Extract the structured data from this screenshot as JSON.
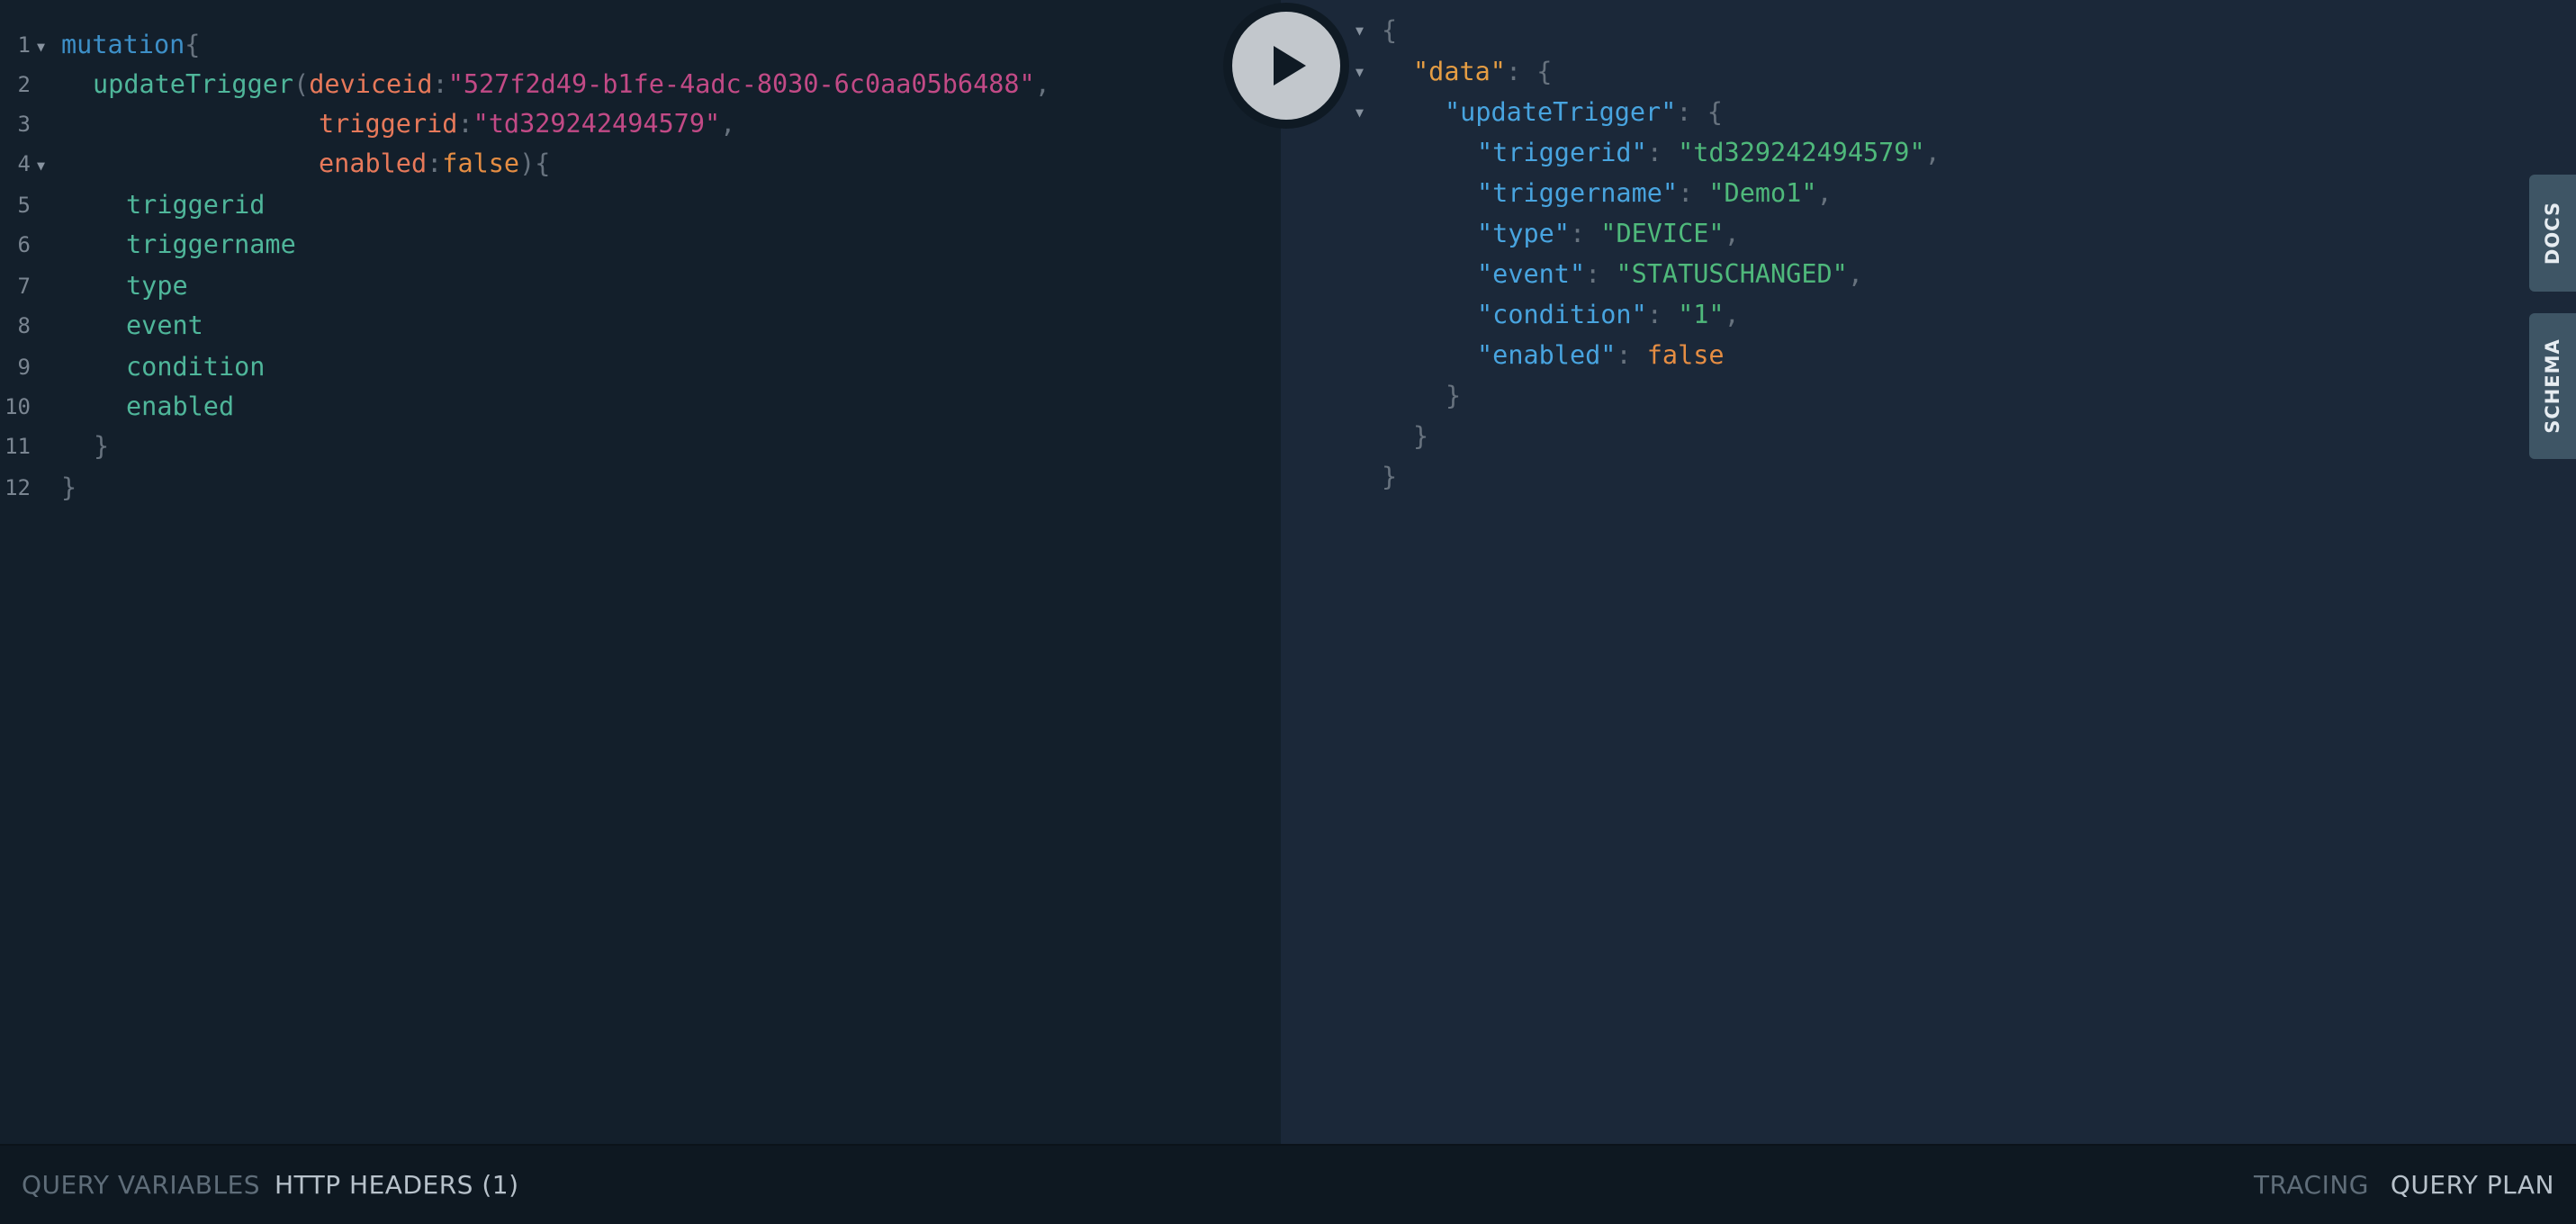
{
  "query_editor": {
    "line_numbers": [
      "1",
      "2",
      "3",
      "4",
      "5",
      "6",
      "7",
      "8",
      "9",
      "10",
      "11",
      "12"
    ],
    "keyword": "mutation",
    "operation": "updateTrigger",
    "arg_deviceid_name": "deviceid",
    "arg_deviceid_value": "\"527f2d49-b1fe-4adc-8030-6c0aa05b6488\"",
    "arg_triggerid_name": "triggerid",
    "arg_triggerid_value": "\"td329242494579\"",
    "arg_enabled_name": "enabled",
    "arg_enabled_value": "false",
    "fields": [
      "triggerid",
      "triggername",
      "type",
      "event",
      "condition",
      "enabled"
    ]
  },
  "result": {
    "data_key": "\"data\"",
    "update_key": "\"updateTrigger\"",
    "entries": [
      {
        "key": "\"triggerid\"",
        "value": "\"td329242494579\""
      },
      {
        "key": "\"triggername\"",
        "value": "\"Demo1\""
      },
      {
        "key": "\"type\"",
        "value": "\"DEVICE\""
      },
      {
        "key": "\"event\"",
        "value": "\"STATUSCHANGED\""
      },
      {
        "key": "\"condition\"",
        "value": "\"1\""
      },
      {
        "key": "\"enabled\"",
        "value": "false"
      }
    ]
  },
  "side_tabs": {
    "docs": "DOCS",
    "schema": "SCHEMA"
  },
  "bottom_bar": {
    "query_variables": "QUERY VARIABLES",
    "http_headers": "HTTP HEADERS (1)",
    "tracing": "TRACING",
    "query_plan": "QUERY PLAN"
  },
  "colors": {
    "editor_bg": "#131f2b",
    "result_bg": "#1b2839",
    "keyword": "#3d8fc7",
    "field": "#4fb69a",
    "argument": "#e7795a",
    "string": "#c24a86",
    "boolean": "#e58d43"
  },
  "icons": {
    "run": "play-icon",
    "fold": "fold-arrow-icon"
  }
}
